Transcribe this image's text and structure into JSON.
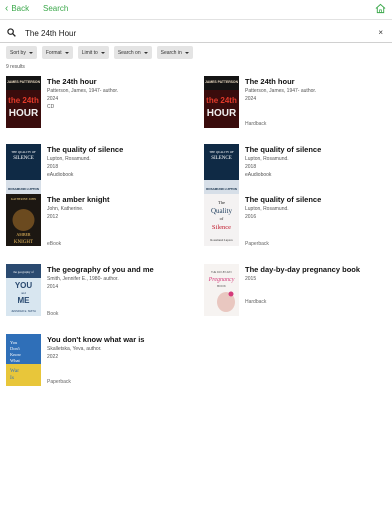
{
  "header": {
    "back_label": "Back",
    "title": "Search"
  },
  "search": {
    "query": "The 24th Hour",
    "clear": "×"
  },
  "filters": [
    "Sort by",
    "Format",
    "Limit to",
    "Search on",
    "Search in"
  ],
  "results_count": "9 results",
  "results": [
    {
      "title": "The 24th hour",
      "author": "Patterson, James, 1947- author.",
      "year": "2024",
      "format": "CD",
      "cover": "patterson"
    },
    {
      "title": "The 24th hour",
      "author": "Patterson, James, 1947- author.",
      "year": "2024",
      "format": "Hardback",
      "cover": "patterson"
    },
    {
      "title": "The quality of silence",
      "author": "Lupton, Rosamund.",
      "year": "2018",
      "format": "eAudiobook",
      "cover": "silence_audio"
    },
    {
      "title": "The quality of silence",
      "author": "Lupton, Rosamund.",
      "year": "2018",
      "format": "eAudiobook",
      "cover": "silence_audio"
    },
    {
      "title": "The amber knight",
      "author": "John, Katherine.",
      "year": "2012",
      "format": "eBook",
      "cover": "amber"
    },
    {
      "title": "The quality of silence",
      "author": "Lupton, Rosamund.",
      "year": "2016",
      "format": "Paperback",
      "cover": "silence_paper"
    },
    {
      "title": "The geography of you and me",
      "author": "Smith, Jennifer E., 1980- author.",
      "year": "2014",
      "format": "Book",
      "cover": "geography"
    },
    {
      "title": "The day-by-day pregnancy book",
      "author": "",
      "year": "2015",
      "format": "Hardback",
      "cover": "pregnancy"
    },
    {
      "title": "You don't know what war is",
      "author": "Skalletska, Yeva, author.",
      "year": "2022",
      "format": "Paperback",
      "cover": "war"
    }
  ],
  "covers": {
    "patterson": {
      "author": "JAMES PATTERSON",
      "big": "the 24th",
      "big2": "HOUR"
    },
    "silence_audio": {
      "line1": "THE QUALITY OF",
      "line2": "SILENCE",
      "author": "ROSAMUND LUPTON"
    },
    "amber": {
      "author": "KATHERINE JOHN",
      "line1": "AMBER",
      "line2": "KNIGHT"
    },
    "silence_paper": {
      "line1": "The",
      "line2": "Quality",
      "line3": "of",
      "line4": "Silence",
      "author": "Rosamund Lupton"
    },
    "geography": {
      "line1": "the geography of",
      "line2": "YOU",
      "line3": "and",
      "line4": "ME",
      "author": "JENNIFER E. SMITH"
    },
    "pregnancy": {
      "line1": "THE DAY-BY-DAY",
      "line2": "Pregnancy",
      "line3": "BOOK"
    },
    "war": {
      "line1": "You",
      "line2": "Don't",
      "line3": "Know",
      "line4": "What",
      "line5": "War",
      "line6": "Is"
    }
  },
  "colors": {
    "accent": "#3aa84a"
  }
}
